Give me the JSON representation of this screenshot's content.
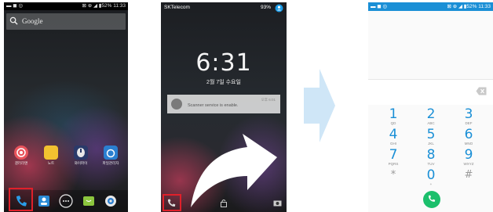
{
  "phone1": {
    "status_left": "▬ ◼ ◎",
    "status_right": "⊠ ⊕ ◢ ▮52% 11:33",
    "search_placeholder": "Google",
    "apps": [
      {
        "label": "갤러리앤",
        "color": "#e8545c"
      },
      {
        "label": "노트",
        "color": "#f2c230"
      },
      {
        "label": "와이파이",
        "color": "#2a3a6a"
      },
      {
        "label": "파일관리자",
        "color": "#2b7fd0"
      }
    ]
  },
  "phone2": {
    "carrier": "SKTelecom",
    "status_right": "93%",
    "time": "6:31",
    "date": "2월 7일 수요일",
    "notification_text": "Scanner service is enable.",
    "notification_time": "오후 6:01"
  },
  "phone3": {
    "status_left": "▬ ◼ ◎",
    "status_right": "⊠ ⊕ ◢ ▮52% 11:33",
    "keys": [
      {
        "digit": "1",
        "letters": "QD"
      },
      {
        "digit": "2",
        "letters": "ABC"
      },
      {
        "digit": "3",
        "letters": "DEF"
      },
      {
        "digit": "4",
        "letters": "GHI"
      },
      {
        "digit": "5",
        "letters": "JKL"
      },
      {
        "digit": "6",
        "letters": "MNO"
      },
      {
        "digit": "7",
        "letters": "PQRS"
      },
      {
        "digit": "8",
        "letters": "TUV"
      },
      {
        "digit": "9",
        "letters": "WXYZ"
      },
      {
        "digit": "*",
        "letters": ""
      },
      {
        "digit": "0",
        "letters": "+"
      },
      {
        "digit": "#",
        "letters": ""
      }
    ]
  },
  "colors": {
    "highlight": "#e0202a",
    "dialer_accent": "#1a8fd6",
    "call_button": "#1cbf6c",
    "arrow_fill": "#cfe6f7"
  }
}
